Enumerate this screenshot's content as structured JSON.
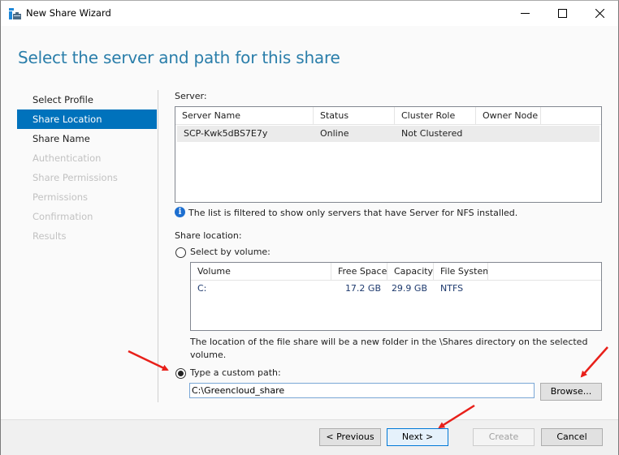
{
  "window": {
    "title": "New Share Wizard",
    "controls": [
      "minimize",
      "maximize",
      "close"
    ]
  },
  "page": {
    "heading": "Select the server and path for this share"
  },
  "nav": {
    "items": [
      {
        "label": "Select Profile",
        "state": "normal"
      },
      {
        "label": "Share Location",
        "state": "active"
      },
      {
        "label": "Share Name",
        "state": "normal"
      },
      {
        "label": "Authentication",
        "state": "disabled"
      },
      {
        "label": "Share Permissions",
        "state": "disabled"
      },
      {
        "label": "Permissions",
        "state": "disabled"
      },
      {
        "label": "Confirmation",
        "state": "disabled"
      },
      {
        "label": "Results",
        "state": "disabled"
      }
    ]
  },
  "server": {
    "label": "Server:",
    "columns": [
      "Server Name",
      "Status",
      "Cluster Role",
      "Owner Node"
    ],
    "rows": [
      [
        "SCP-Kwk5dBS7E7y",
        "Online",
        "Not Clustered",
        ""
      ]
    ],
    "info_text": "The list is filtered to show only servers that have Server for NFS installed."
  },
  "share_location": {
    "label": "Share location:",
    "by_volume_label": "Select by volume:",
    "by_volume_selected": false,
    "volume_columns": [
      "Volume",
      "Free Space",
      "Capacity",
      "File System"
    ],
    "volume_rows": [
      [
        "C:",
        "17.2 GB",
        "29.9 GB",
        "NTFS"
      ]
    ],
    "volume_note": "The location of the file share will be a new folder in the \\Shares directory on the selected volume.",
    "custom_path_label": "Type a custom path:",
    "custom_path_selected": true,
    "custom_path_value": "C:\\Greencloud_share",
    "browse_label": "Browse..."
  },
  "footer": {
    "previous_label": "< Previous",
    "next_label": "Next >",
    "create_label": "Create",
    "cancel_label": "Cancel"
  },
  "annotations": {
    "arrow_color": "#e8201a"
  },
  "colors": {
    "accent": "#0072bc",
    "heading": "#2a7eaa"
  }
}
